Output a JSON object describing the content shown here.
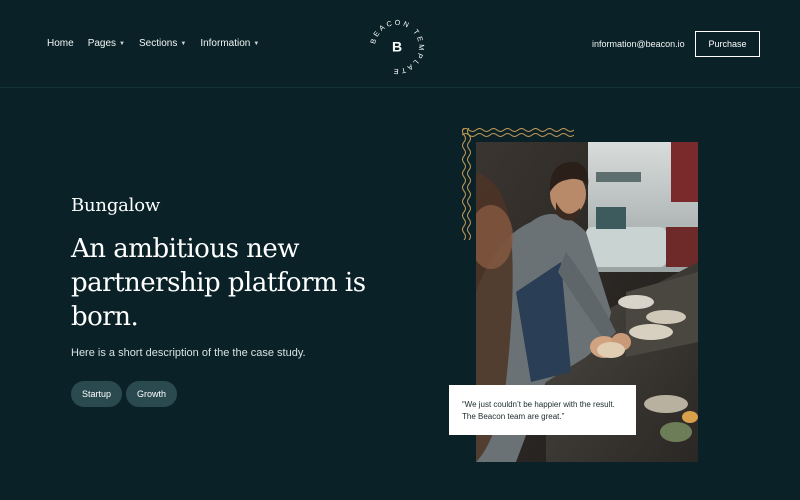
{
  "nav": {
    "items": [
      {
        "label": "Home",
        "has_dropdown": false
      },
      {
        "label": "Pages",
        "has_dropdown": true
      },
      {
        "label": "Sections",
        "has_dropdown": true
      },
      {
        "label": "Information",
        "has_dropdown": true
      }
    ]
  },
  "logo": {
    "letter": "B",
    "ring_text": "BEACON TEMPLATE"
  },
  "header": {
    "email": "information@beacon.io",
    "purchase_label": "Purchase"
  },
  "hero": {
    "eyebrow": "Bungalow",
    "headline": "An ambitious new partnership platform is born.",
    "description": "Here is a short description of the the case study.",
    "tags": [
      "Startup",
      "Growth"
    ]
  },
  "quote": {
    "text": "“We just couldn’t be happier with the result. The Beacon team are great.”"
  },
  "icons": {
    "dropdown": "chevron-down-icon",
    "logo": "beacon-logo-icon"
  },
  "colors": {
    "background": "#0a2227",
    "tag": "#2a4a50",
    "accent": "#c49a58",
    "white": "#ffffff"
  }
}
